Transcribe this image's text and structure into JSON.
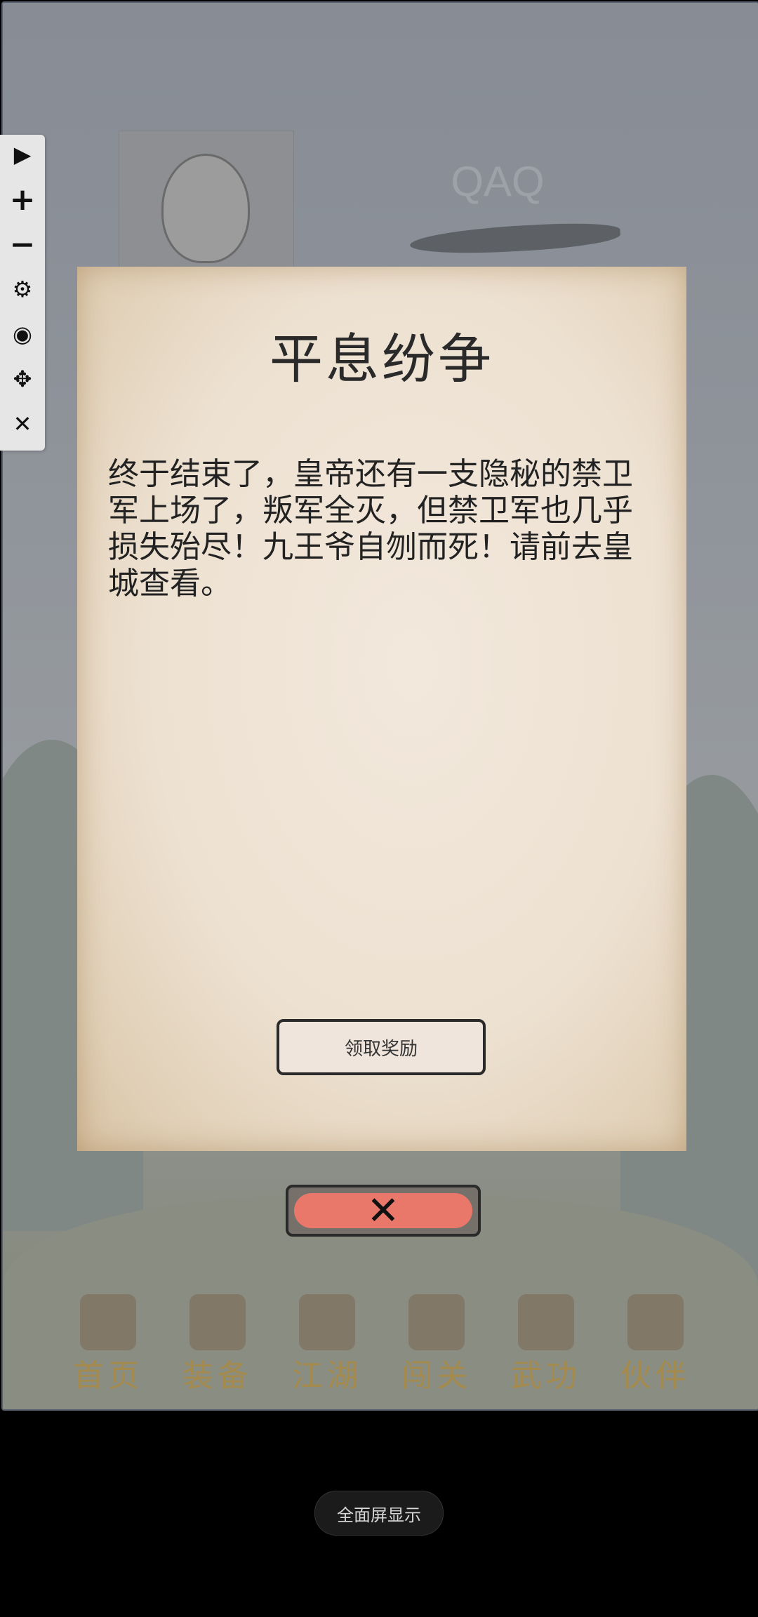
{
  "game": {
    "player_name": "QAQ",
    "nav_items": [
      {
        "label": "首页"
      },
      {
        "label": "装备"
      },
      {
        "label": "江湖"
      },
      {
        "label": "闯关"
      },
      {
        "label": "武功"
      },
      {
        "label": "伙伴"
      }
    ]
  },
  "toolbar": {
    "buttons": [
      {
        "icon": "play-icon",
        "glyph": "▶"
      },
      {
        "icon": "zoom-in-icon",
        "glyph": "+"
      },
      {
        "icon": "zoom-out-icon",
        "glyph": "−"
      },
      {
        "icon": "gear-icon",
        "glyph": "⚙"
      },
      {
        "icon": "eye-off-icon",
        "glyph": "◉"
      },
      {
        "icon": "move-icon",
        "glyph": "✥"
      },
      {
        "icon": "close-icon",
        "glyph": "✕"
      }
    ]
  },
  "dialog": {
    "title": "平息纷争",
    "body": "终于结束了，皇帝还有一支隐秘的禁卫军上场了，叛军全灭，但禁卫军也几乎损失殆尽！九王爷自刎而死！请前去皇城查看。",
    "reward_label": "领取奖励",
    "close_glyph": "✕"
  },
  "system": {
    "fullscreen_label": "全面屏显示"
  }
}
